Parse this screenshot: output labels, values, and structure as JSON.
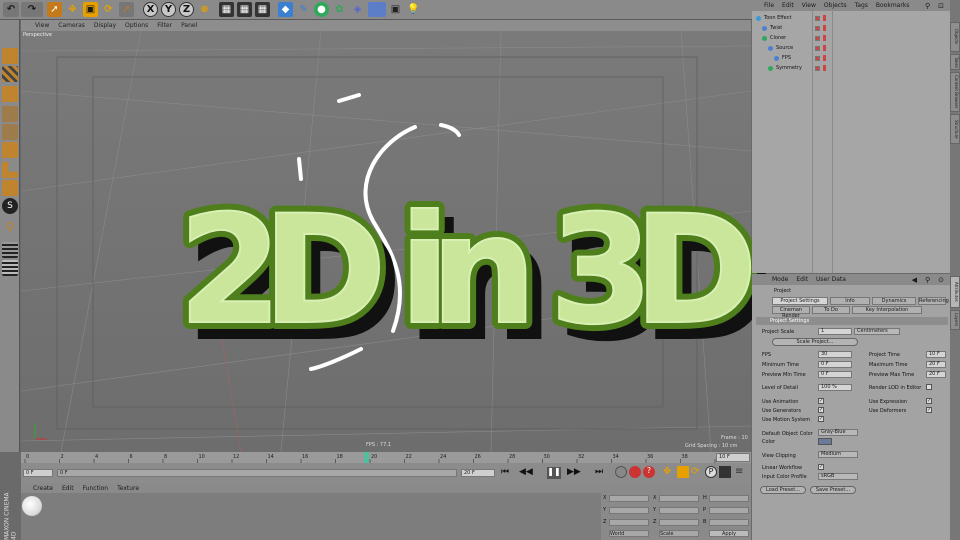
{
  "colors": {
    "title_fill": "#c9e69a",
    "title_stroke": "#6aa52a",
    "title_shadow": "#111111",
    "accent": "#4f8fd9"
  },
  "toolbar": {
    "icons": [
      "arrow-icon",
      "move-icon",
      "scale-icon",
      "rotate-icon",
      "select-icon",
      "x-axis-icon",
      "y-axis-icon",
      "z-axis-icon",
      "coord-system-icon",
      "render-view-icon",
      "render-picture-icon",
      "render-settings-icon",
      "cube-icon",
      "pen-icon",
      "subdivision-icon",
      "array-icon",
      "deformer-icon",
      "scene-icon",
      "camera-icon",
      "light-icon"
    ],
    "x_label": "X",
    "y_label": "Y",
    "z_label": "Z"
  },
  "viewport": {
    "menu": [
      "View",
      "Cameras",
      "Display",
      "Options",
      "Filter",
      "Panel"
    ],
    "label": "Perspective",
    "fps": "FPS : 77.1",
    "frame": "Frame : 10",
    "grid_spacing": "Grid Spacing : 10 cm"
  },
  "title_overlay": {
    "text": "2D in 3D"
  },
  "timeline": {
    "ticks": [
      "0",
      "2",
      "4",
      "6",
      "8",
      "10",
      "12",
      "14",
      "16",
      "18",
      "20",
      "22",
      "24",
      "26",
      "28",
      "30",
      "32",
      "34",
      "36",
      "38",
      "40"
    ],
    "current": "10 F",
    "start": "0 F",
    "start2": "0 F",
    "end": "20 F",
    "end2": "20 F"
  },
  "material": {
    "menu": [
      "Create",
      "Edit",
      "Function",
      "Texture"
    ],
    "brand": "MAXON CINEMA 4D"
  },
  "objects": {
    "menu": [
      "File",
      "Edit",
      "View",
      "Objects",
      "Tags",
      "Bookmarks"
    ],
    "rows": [
      {
        "name": "Toon Effect",
        "indent": 0
      },
      {
        "name": "Twist",
        "indent": 1
      },
      {
        "name": "Cloner",
        "indent": 1
      },
      {
        "name": "Source",
        "indent": 2
      },
      {
        "name": "FPS",
        "indent": 3
      },
      {
        "name": "Symmetry",
        "indent": 2
      }
    ]
  },
  "right_tabs": [
    "Objects",
    "Takes",
    "Content Browser",
    "Structure",
    "Attributes",
    "Layers"
  ],
  "attributes": {
    "menu": [
      "Mode",
      "Edit",
      "User Data"
    ],
    "section": "Project",
    "tabs": [
      "Project Settings",
      "Info",
      "Dynamics",
      "Referencing",
      "To Do",
      "Key Interpolation",
      "Cineman Render"
    ],
    "settings_header": "Project Settings",
    "project_scale_label": "Project Scale",
    "project_scale_value": "1",
    "project_scale_unit": "Centimeters",
    "scale_project_btn": "Scale Project...",
    "fps_label": "FPS",
    "fps_value": "30",
    "project_time_label": "Project Time",
    "project_time_value": "10 F",
    "min_time_label": "Minimum Time",
    "min_time_value": "0 F",
    "max_time_label": "Maximum Time",
    "max_time_value": "20 F",
    "prev_min_label": "Preview Min Time",
    "prev_min_value": "0 F",
    "prev_max_label": "Preview Max Time",
    "prev_max_value": "20 F",
    "lod_label": "Level of Detail",
    "lod_value": "100 %",
    "render_lod_label": "Render LOD in Editor",
    "use_animation": "Use Animation",
    "use_expression": "Use Expression",
    "use_generators": "Use Generators",
    "use_deformers": "Use Deformers",
    "use_motion": "Use Motion System",
    "default_color_label": "Default Object Color",
    "default_color_value": "Gray-Blue",
    "color_label": "Color",
    "view_clipping_label": "View Clipping",
    "view_clipping_value": "Medium",
    "linear_workflow": "Linear Workflow",
    "input_profile_label": "Input Color Profile",
    "input_profile_value": "sRGB",
    "load_preset": "Load Preset...",
    "save_preset": "Save Preset..."
  },
  "coords": {
    "x": "X",
    "y": "Y",
    "z": "Z",
    "h": "H",
    "p": "P",
    "b": "B",
    "world": "World",
    "scale": "Scale",
    "apply": "Apply",
    "cm": "0 cm"
  }
}
